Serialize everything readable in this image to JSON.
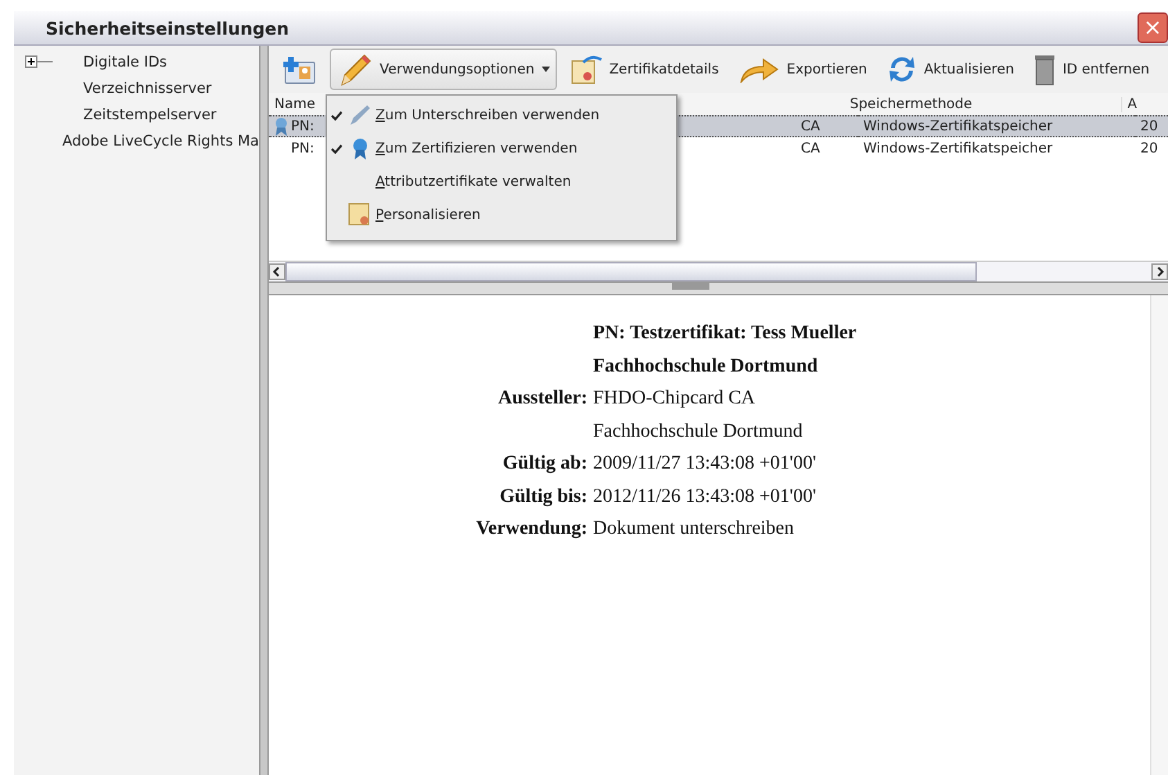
{
  "window": {
    "title": "Sicherheitseinstellungen",
    "close": "×"
  },
  "sidebar": {
    "items": [
      {
        "label": "Digitale IDs",
        "expanded": false
      },
      {
        "label": "Verzeichnisserver"
      },
      {
        "label": "Zeitstempelserver"
      },
      {
        "label": "Adobe LiveCycle Rights Ma"
      }
    ]
  },
  "toolbar": [
    {
      "kind": "add",
      "selected": false
    },
    {
      "kind": "pencil",
      "label": "Verwendungsoptionen",
      "dropdown": true,
      "selected": true
    },
    {
      "kind": "certificate",
      "label": "Zertifikatdetails",
      "selected": false
    },
    {
      "kind": "export",
      "label": "Exportieren",
      "selected": false
    },
    {
      "kind": "refresh",
      "label": "Aktualisieren",
      "selected": false
    },
    {
      "kind": "trash",
      "label": "ID entfernen",
      "selected": false
    }
  ],
  "menu": {
    "items": [
      {
        "kind": "pencil",
        "label": "Zum Unterschreiben verwenden",
        "checked": true
      },
      {
        "kind": "ribbon",
        "label": "Zum Zertifizieren verwenden",
        "checked": true
      },
      {
        "kind": "none",
        "label": "Attributzertifikate verwalten",
        "checked": false
      },
      {
        "kind": "certificate",
        "label": "Personalisieren",
        "checked": false
      }
    ]
  },
  "table": {
    "columns": [
      {
        "label": "Name"
      },
      {},
      {
        "label": "Speichermethode"
      },
      {
        "label": "A"
      }
    ],
    "rows": [
      {
        "selected": true,
        "icon": true,
        "cells": [
          "PN:",
          "CA",
          "Windows-Zertifikatspeicher",
          "20"
        ]
      },
      {
        "selected": false,
        "cells": [
          "PN:",
          "CA",
          "Windows-Zertifikatspeicher",
          "20"
        ]
      }
    ]
  },
  "details": [
    {
      "kind": "heading",
      "value": "PN: Testzertifikat: Tess Mueller"
    },
    {
      "kind": "heading",
      "value": "Fachhochschule Dortmund"
    },
    {
      "kind": "field",
      "label": "Aussteller:",
      "value": "FHDO-Chipcard CA"
    },
    {
      "kind": "field",
      "value": "Fachhochschule Dortmund"
    },
    {
      "kind": "field",
      "label": "Gültig ab:",
      "value": "2009/11/27 13:43:08 +01'00'"
    },
    {
      "kind": "field",
      "label": "Gültig bis:",
      "value": "2012/11/26 13:43:08 +01'00'"
    },
    {
      "kind": "field",
      "label": "Verwendung:",
      "value": "Dokument unterschreiben"
    }
  ]
}
